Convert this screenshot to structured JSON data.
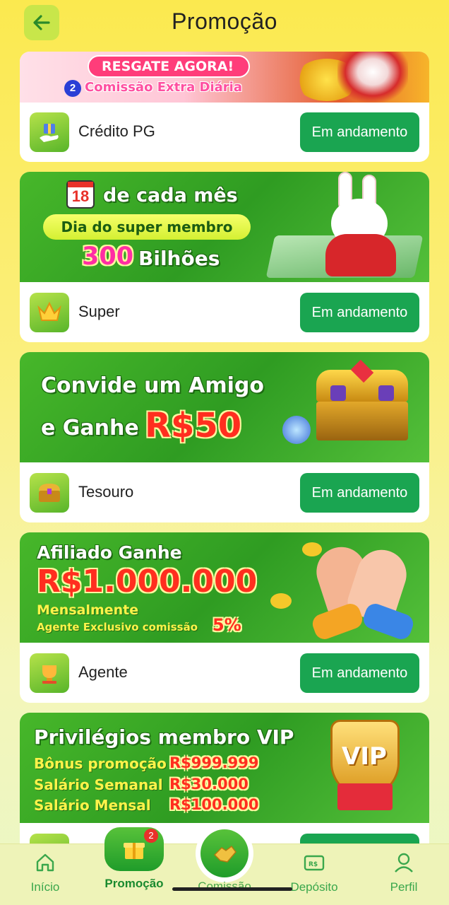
{
  "header": {
    "title": "Promoção",
    "back_icon": "arrow-left-icon"
  },
  "cards": [
    {
      "banner_texts": {
        "cta": "RESGATE AGORA!",
        "badge_num": "2",
        "subtitle": "Comissão Extra Diária"
      },
      "name": "Crédito PG",
      "icon": "gift-hand-icon",
      "status": "Em andamento"
    },
    {
      "banner_texts": {
        "day": "18",
        "line1": "de cada mês",
        "pill": "Dia do super membro",
        "amount": "300",
        "amount_unit": "Bilhões"
      },
      "name": "Super",
      "icon": "crown-icon",
      "status": "Em andamento"
    },
    {
      "banner_texts": {
        "line1": "Convide um Amigo",
        "line2": "e Ganhe",
        "amount": "R$50"
      },
      "name": "Tesouro",
      "icon": "treasure-chest-icon",
      "status": "Em andamento"
    },
    {
      "banner_texts": {
        "line1": "Afiliado Ganhe",
        "amount": "R$1.000.000",
        "line2": "Mensalmente",
        "line3": "Agente Exclusivo comissão",
        "percent": "5%"
      },
      "name": "Agente",
      "icon": "trophy-icon",
      "status": "Em andamento"
    },
    {
      "banner_texts": {
        "title": "Privilégios membro VIP",
        "rows": [
          {
            "label": "Bônus promoção",
            "value": "R$999.999"
          },
          {
            "label": "Salário Semanal",
            "value": "R$30.000"
          },
          {
            "label": "Salário Mensal",
            "value": "R$100.000"
          }
        ],
        "shield": "VIP"
      },
      "name": "",
      "icon": "vip-icon",
      "status": ""
    }
  ],
  "nav": [
    {
      "label": "Início",
      "icon": "home-icon",
      "active": false
    },
    {
      "label": "Promoção",
      "icon": "gift-icon",
      "active": true,
      "badge": "2"
    },
    {
      "label": "Comissão",
      "icon": "handshake-icon",
      "active": false
    },
    {
      "label": "Depósito",
      "icon": "wallet-icon",
      "active": false
    },
    {
      "label": "Perfil",
      "icon": "user-icon",
      "active": false
    }
  ],
  "colors": {
    "accent_green": "#1aa551",
    "background_yellow": "#fbe94f",
    "nav_green": "#3aa74c"
  }
}
